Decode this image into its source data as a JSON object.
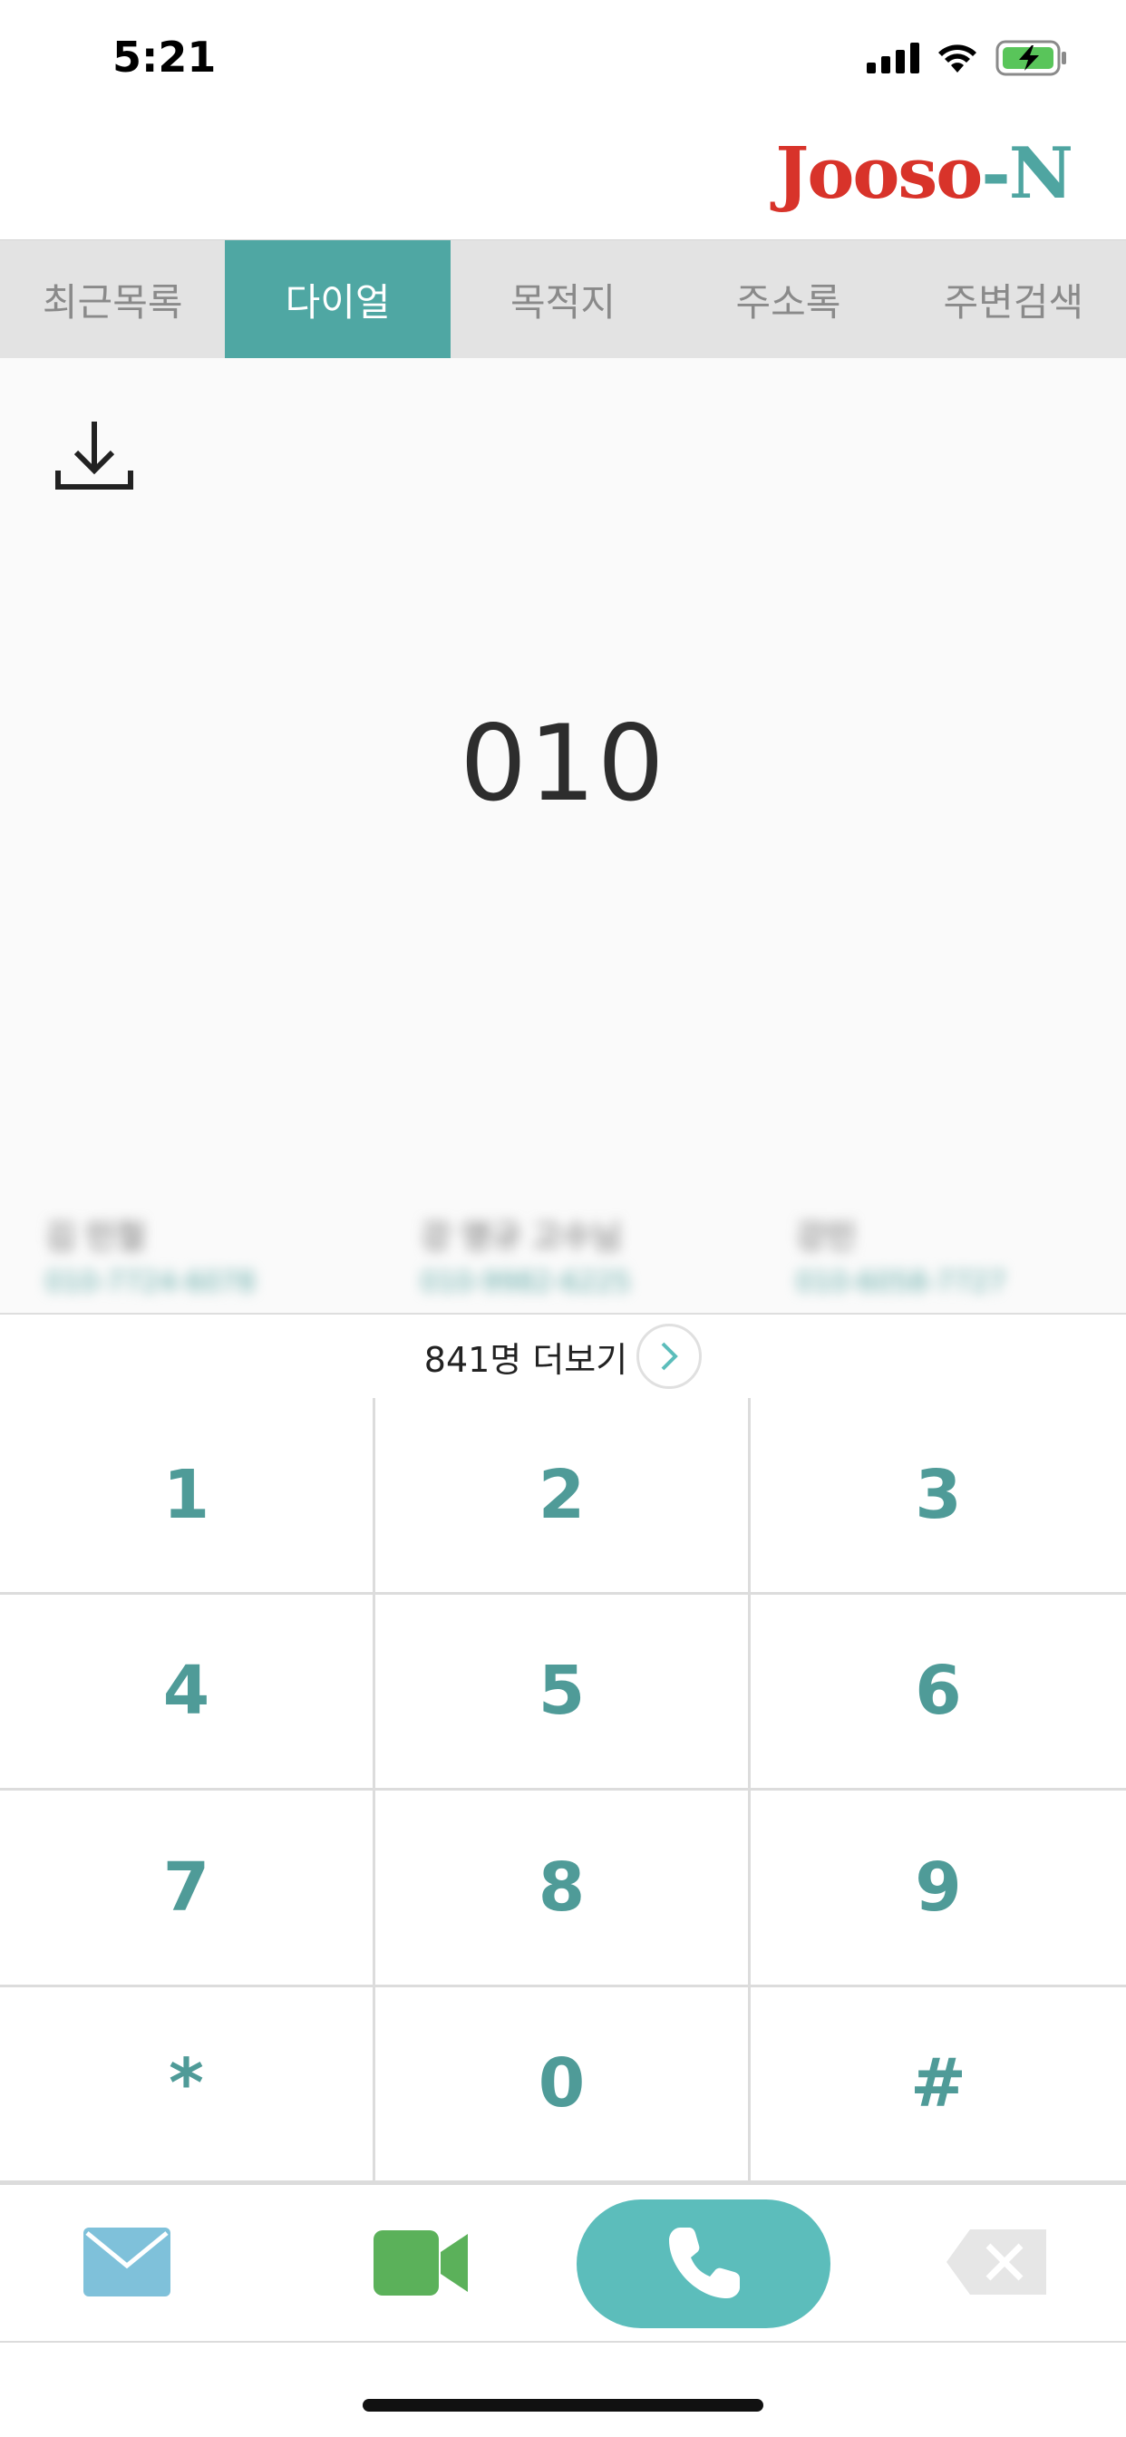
{
  "status_bar": {
    "time": "5:21"
  },
  "header": {
    "logo_red": "Jooso",
    "logo_teal": "-N"
  },
  "tabs": [
    {
      "label": "최근목록",
      "active": false
    },
    {
      "label": "다이얼",
      "active": true
    },
    {
      "label": "목적지",
      "active": false
    },
    {
      "label": "주소록",
      "active": false
    },
    {
      "label": "주변검색",
      "active": false
    }
  ],
  "dialer": {
    "number": "010",
    "download_icon": "download-icon"
  },
  "suggestions": [
    {
      "name": "김 민철",
      "phone": "010-7724-6078"
    },
    {
      "name": "강 영규 고수님",
      "phone": "010-9982-6225"
    },
    {
      "name": "강민",
      "phone": "010-6058-7727"
    }
  ],
  "more": {
    "label": "841명 더보기"
  },
  "keypad": [
    "1",
    "2",
    "3",
    "4",
    "5",
    "6",
    "7",
    "8",
    "9",
    "*",
    "0",
    "#"
  ],
  "actions": {
    "mail_icon": "mail-icon",
    "video_icon": "video-call-icon",
    "call_icon": "phone-icon",
    "backspace_icon": "backspace-icon"
  },
  "colors": {
    "accent": "#4fa7a3",
    "call": "#5cbdbb",
    "logo_red": "#d8332a",
    "mail": "#7fc1da",
    "video": "#5bb15a"
  }
}
